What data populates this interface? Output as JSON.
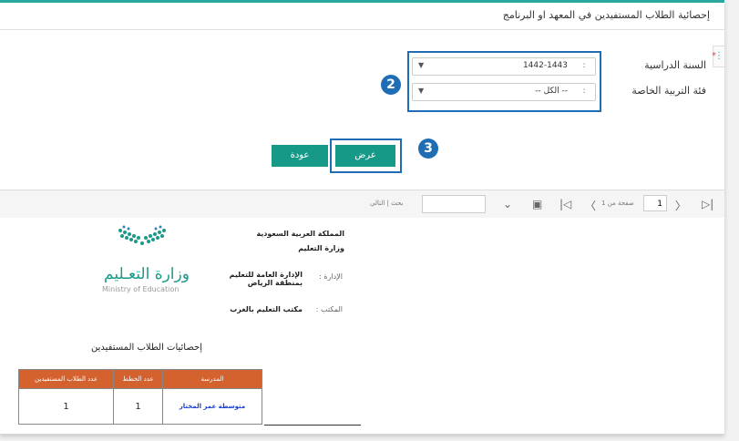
{
  "page_title": "إحصائية الطلاب المستفيدين في المعهد او البرنامج",
  "form": {
    "year_label": "السنة الدراسية",
    "year_value": "1442-1443",
    "category_label": "فئة التربية الخاصة",
    "category_value": "-- الكل --",
    "required_mark": "*"
  },
  "annotations": {
    "badge_2": "2",
    "badge_3": "3"
  },
  "buttons": {
    "show": "عرض",
    "back": "عودة"
  },
  "viewer": {
    "page_value": "1",
    "page_of": "صفحة من 1",
    "search_hint": "بحث | التالي"
  },
  "report": {
    "kingdom": "المملكة العربية السعودية",
    "ministry": "وزارة التعليم",
    "admin_label": "الإدارة :",
    "admin_value": "الإدارة العامة للتعليم بمنطقة الرياض",
    "office_label": "المكتب :",
    "office_value": "مكتب التعليم بالغرب",
    "logo_ar": "وزارة التعـليم",
    "logo_en": "Ministry of Education",
    "title": "إحصائيات الطلاب المستفيدين",
    "table": {
      "headers": [
        "المدرسة",
        "عدد الخطط",
        "عدد الطلاب المستفيدين"
      ],
      "rows": [
        [
          "متوسطة عمر المختار",
          "1",
          "1"
        ]
      ]
    }
  },
  "colors": {
    "accent": "#169a87",
    "highlight": "#1f6db5",
    "table_header": "#d3622f"
  }
}
